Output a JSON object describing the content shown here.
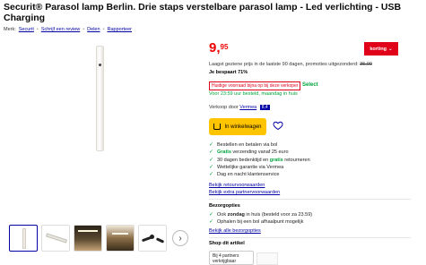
{
  "product": {
    "title": "Securit® Parasol lamp Berlin. Drie staps verstelbare parasol lamp - Led verlichting - USB Charging"
  },
  "meta": {
    "brand_label": "Merk:",
    "brand": "Securit",
    "review_link": "Schrijf een review",
    "share_link": "Delen",
    "report_link": "Rapporteer"
  },
  "pricing": {
    "price_main": "9,",
    "price_cents": "95",
    "korting_label": "korting",
    "lowest_price_text": "Laagst geziene prijs in de laatste 90 dagen, promoties uitgezonderd:",
    "old_price": "35,00",
    "savings": "Je bespaart 71%"
  },
  "deal": {
    "badge": "Huidige voorraad bijna op bij deze verkoper",
    "select": "Select"
  },
  "delivery": {
    "text": "Voor 23:59 uur besteld, maandag in huis"
  },
  "seller": {
    "label": "Verkoop door",
    "name": "Vermea",
    "score": "8,4"
  },
  "cart": {
    "label": "In winkelwagen"
  },
  "benefits": [
    {
      "pre": "",
      "bold": "",
      "text": "Bestellen en betalen via bol"
    },
    {
      "pre": "",
      "bold": "Gratis",
      "text": " verzending vanaf 25 euro"
    },
    {
      "pre": "30 dagen bedenktijd en ",
      "bold": "gratis",
      "text": " retourneren"
    },
    {
      "pre": "",
      "bold": "",
      "text": "Wettelijke garantie via Vermea"
    },
    {
      "pre": "",
      "bold": "",
      "text": "Dag en nacht klantenservice"
    }
  ],
  "links": {
    "retour": "Bekijk retourvoorwaarden",
    "extra": "Bekijk extra partnervoorwaarden",
    "all_delivery": "Bekijk alle bezorgopties"
  },
  "bezorg": {
    "title": "Bezorgopties",
    "options": [
      {
        "pre": "Ook ",
        "bold": "zondag",
        "text": " in huis (besteld voor za 23.59)"
      },
      {
        "pre": "",
        "bold": "",
        "text": "Ophalen bij een bol afhaalpunt mogelijk"
      }
    ]
  },
  "shop": {
    "title": "Shop dit artikel",
    "partners": "Bij 4 partners verkrijgbaar"
  },
  "colors": {
    "accent_red": "#e0001a",
    "brand_blue": "#0000a4",
    "cta_yellow": "#ffc400",
    "green": "#00a33b"
  }
}
